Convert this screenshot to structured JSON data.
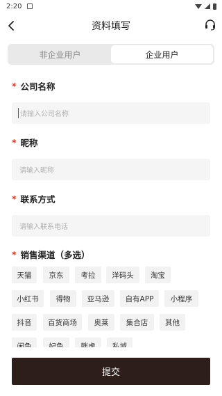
{
  "status_bar": {
    "time": "2:20"
  },
  "header": {
    "title": "资料填写",
    "back_icon": "chevron-left-icon",
    "service_icon": "headset-icon"
  },
  "user_type": {
    "options": [
      "非企业用户",
      "企业用户"
    ],
    "selected": "企业用户"
  },
  "form": {
    "required_mark": "*",
    "company": {
      "label": "公司名称",
      "placeholder": "请输入公司名称"
    },
    "nickname": {
      "label": "昵称",
      "placeholder": "请输入昵称"
    },
    "contact": {
      "label": "联系方式",
      "placeholder": "请输入联系电话"
    },
    "channels": {
      "label": "销售渠道（多选）",
      "options": [
        "天猫",
        "京东",
        "考拉",
        "洋码头",
        "淘宝",
        "小红书",
        "得物",
        "亚马逊",
        "自有APP",
        "小程序",
        "抖音",
        "百货商场",
        "奥莱",
        "集合店",
        "其他",
        "闲鱼",
        "妃鱼",
        "胖虎",
        "私域"
      ]
    }
  },
  "submit_label": "提交",
  "colors": {
    "accent": "#2d1e1c",
    "required": "#d23a2a",
    "input_bg": "#f5f5f5",
    "tag_bg": "#f2f2f2"
  }
}
